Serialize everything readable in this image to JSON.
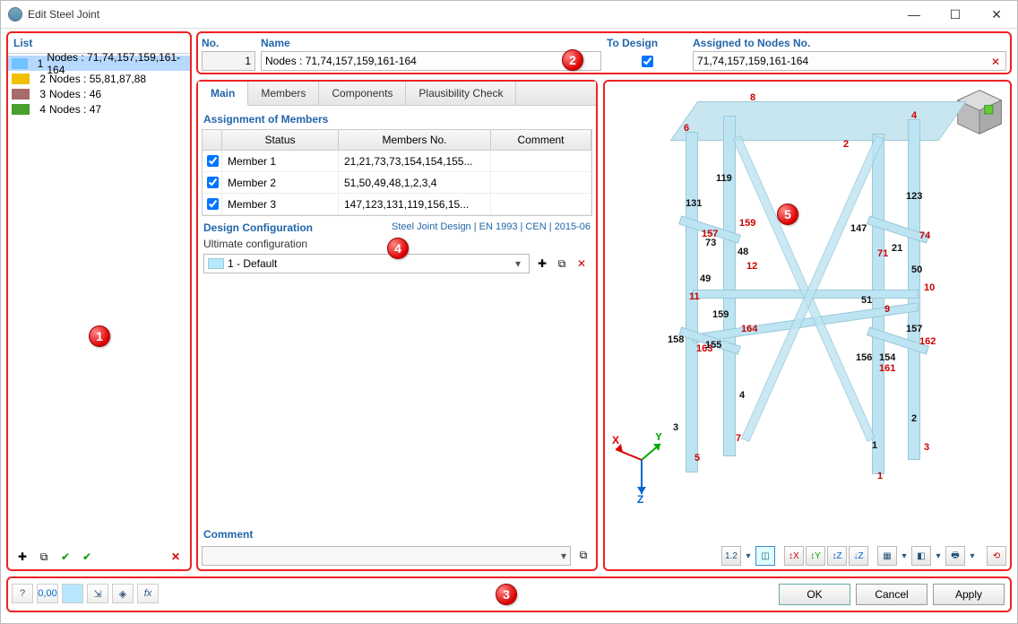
{
  "window": {
    "title": "Edit Steel Joint"
  },
  "list": {
    "header": "List",
    "items": [
      {
        "num": "1",
        "label": "Nodes : 71,74,157,159,161-164",
        "color": "#6fc3ff",
        "selected": true
      },
      {
        "num": "2",
        "label": "Nodes : 55,81,87,88",
        "color": "#f0c000",
        "selected": false
      },
      {
        "num": "3",
        "label": "Nodes : 46",
        "color": "#a86b6b",
        "selected": false
      },
      {
        "num": "4",
        "label": "Nodes : 47",
        "color": "#4aa02c",
        "selected": false
      }
    ]
  },
  "top": {
    "no_label": "No.",
    "no_value": "1",
    "name_label": "Name",
    "name_value": "Nodes : 71,74,157,159,161-164",
    "todesign_label": "To Design",
    "todesign_checked": true,
    "nodes_label": "Assigned to Nodes No.",
    "nodes_value": "71,74,157,159,161-164"
  },
  "tabs": {
    "main": "Main",
    "members": "Members",
    "components": "Components",
    "plaus": "Plausibility Check"
  },
  "assignment": {
    "title": "Assignment of Members",
    "col_status": "Status",
    "col_members": "Members No.",
    "col_comment": "Comment",
    "rows": [
      {
        "status": "Member 1",
        "members": "21,21,73,73,154,154,155...",
        "comment": ""
      },
      {
        "status": "Member 2",
        "members": "51,50,49,48,1,2,3,4",
        "comment": ""
      },
      {
        "status": "Member 3",
        "members": "147,123,131,119,156,15...",
        "comment": ""
      }
    ]
  },
  "design": {
    "title": "Design Configuration",
    "subtitle": "Steel Joint Design | EN 1993 | CEN | 2015-06",
    "config_label": "Ultimate configuration",
    "config_value": "1 - Default"
  },
  "comment": {
    "title": "Comment"
  },
  "viewer": {
    "node_labels": [
      "8",
      "6",
      "4",
      "2",
      "119",
      "123",
      "131",
      "147",
      "159",
      "74",
      "157",
      "21",
      "71",
      "48",
      "50",
      "12",
      "10",
      "49",
      "11",
      "51",
      "9",
      "159",
      "157",
      "164",
      "162",
      "158",
      "155",
      "156",
      "154",
      "163",
      "161",
      "4",
      "2",
      "3",
      "1",
      "7",
      "5",
      "3",
      "1"
    ],
    "axes": {
      "x": "X",
      "y": "Y",
      "z": "Z"
    }
  },
  "buttons": {
    "ok": "OK",
    "cancel": "Cancel",
    "apply": "Apply"
  },
  "badges": {
    "b1": "1",
    "b2": "2",
    "b3": "3",
    "b4": "4",
    "b5": "5"
  }
}
